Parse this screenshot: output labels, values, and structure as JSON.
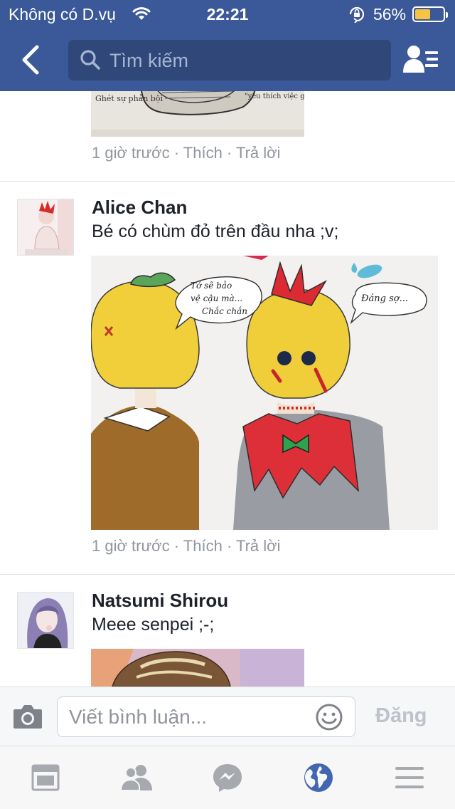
{
  "status_bar": {
    "carrier": "Không có D.vụ",
    "time": "22:21",
    "battery_percent": "56%",
    "battery_level": 0.56,
    "wifi_icon": "wifi-icon",
    "lock_icon": "rotation-lock-icon"
  },
  "nav": {
    "back_icon": "back-chevron-icon",
    "search_placeholder": "Tìm kiếm",
    "friends_icon": "friends-list-icon"
  },
  "comments": [
    {
      "author": "",
      "text": "",
      "image_lettering": [
        "Ghét sự phản bội",
        "\"yêu thích việc giết chóc\""
      ],
      "meta": {
        "time": "1 giờ trước",
        "like": "Thích",
        "reply": "Trả lời"
      }
    },
    {
      "author": "Alice Chan",
      "text": "Bé có chùm đỏ trên đầu nha ;v;",
      "image_lettering": [
        "Tớ sẽ bảo vệ cậu mà... Chắc chắn",
        "Đáng sợ..."
      ],
      "meta": {
        "time": "1 giờ trước",
        "like": "Thích",
        "reply": "Trả lời"
      }
    },
    {
      "author": "Natsumi Shirou",
      "text": "Meee senpei ;-;"
    }
  ],
  "meta_separator": "·",
  "composer": {
    "camera_icon": "camera-icon",
    "placeholder": "Viết bình luận...",
    "emoji_icon": "smiley-icon",
    "post_label": "Đăng"
  },
  "tabs": [
    {
      "icon": "news-feed-icon",
      "active": false
    },
    {
      "icon": "friend-requests-icon",
      "active": false
    },
    {
      "icon": "messenger-icon",
      "active": false
    },
    {
      "icon": "notifications-globe-icon",
      "active": true
    },
    {
      "icon": "more-menu-icon",
      "active": false
    }
  ],
  "colors": {
    "brand_blue": "#3b5998",
    "search_bg": "#2f4779",
    "meta_gray": "#90949c",
    "active_tab": "#4267b2",
    "inactive_tab": "#a6a9ae",
    "battery_fill": "#f6c343"
  }
}
